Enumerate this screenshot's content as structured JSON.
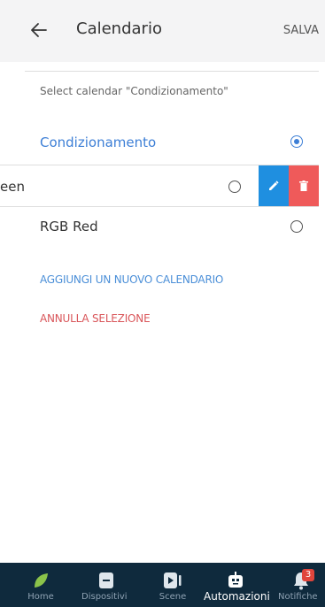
{
  "header": {
    "title": "Calendario",
    "save_label": "SALVA"
  },
  "subtitle": "Select calendar \"Condizionamento\"",
  "calendars": [
    {
      "label": "Condizionamento",
      "selected": true
    },
    {
      "label": "een",
      "selected": false
    },
    {
      "label": "RGB Red",
      "selected": false
    }
  ],
  "actions": {
    "add_label": "AGGIUNGI UN NUOVO CALENDARIO",
    "cancel_label": "ANNULLA SELEZIONE"
  },
  "nav": {
    "items": [
      {
        "label": "Home",
        "icon": "leaf-icon"
      },
      {
        "label": "Dispositivi",
        "icon": "device-icon"
      },
      {
        "label": "Scene",
        "icon": "scene-icon"
      },
      {
        "label": "Automazioni",
        "icon": "robot-icon",
        "active": true
      },
      {
        "label": "Notifiche",
        "icon": "bell-icon",
        "badge": "3"
      }
    ]
  },
  "colors": {
    "accent": "#3d7fd6",
    "danger": "#e05a5a",
    "edit": "#1f8fe0",
    "nav_bg": "#0f2a3d"
  }
}
